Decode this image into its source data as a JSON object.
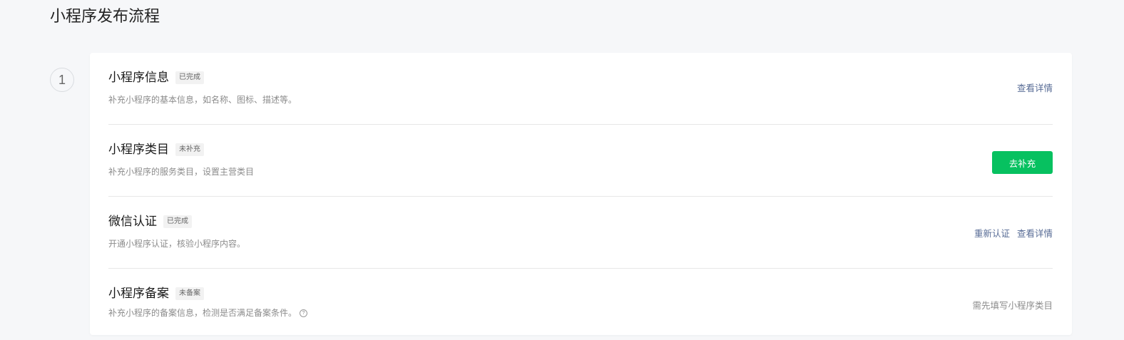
{
  "page": {
    "title": "小程序发布流程"
  },
  "step": {
    "number": "1"
  },
  "colors": {
    "background": "#f6f7f9",
    "card": "#ffffff",
    "primary_button": "#07c160",
    "link": "#576b95",
    "muted_text": "#8c8c8c"
  },
  "items": [
    {
      "title": "小程序信息",
      "status": "已完成",
      "description": "补充小程序的基本信息，如名称、图标、描述等。",
      "actions": {
        "details_link": "查看详情"
      }
    },
    {
      "title": "小程序类目",
      "status": "未补充",
      "description": "补充小程序的服务类目，设置主营类目",
      "actions": {
        "supplement_button": "去补充"
      }
    },
    {
      "title": "微信认证",
      "status": "已完成",
      "description": "开通小程序认证，核验小程序内容。",
      "actions": {
        "reverify_link": "重新认证",
        "details_link": "查看详情"
      }
    },
    {
      "title": "小程序备案",
      "status": "未备案",
      "description": "补充小程序的备案信息，检测是否满足备案条件。",
      "help_icon": "question-circle-icon",
      "actions": {
        "hint": "需先填写小程序类目"
      }
    }
  ]
}
